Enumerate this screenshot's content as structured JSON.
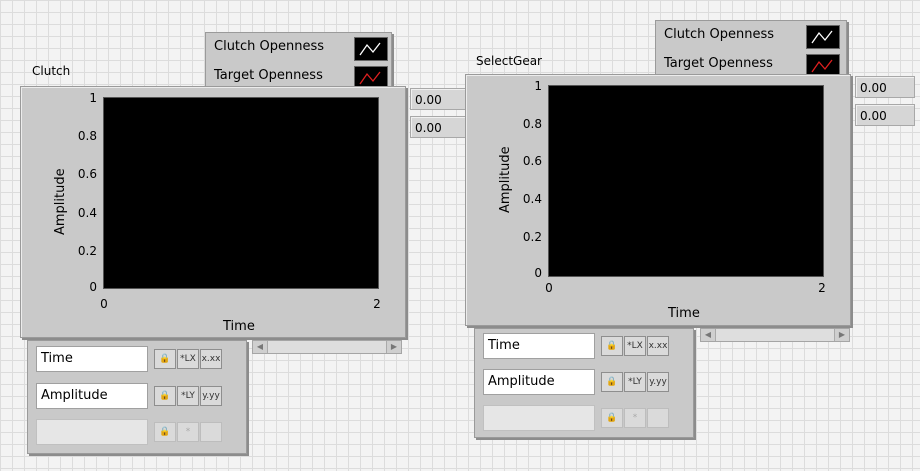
{
  "graphs": [
    {
      "caption": "Clutch",
      "legend": [
        {
          "label": "Clutch Openness",
          "color": "#ffffff"
        },
        {
          "label": "Target Openness",
          "color": "#e02020"
        }
      ],
      "x_axis_title": "Time",
      "y_axis_title": "Amplitude",
      "y_ticks": [
        "1",
        "0.8",
        "0.6",
        "0.4",
        "0.2",
        "0"
      ],
      "x_ticks": [
        "0",
        "2"
      ],
      "digital_displays": [
        "0.00",
        "0.00"
      ],
      "scale_legend": {
        "x_name": "Time",
        "y_name": "Amplitude",
        "x_format": "x.xx",
        "y_format": "y.yy"
      }
    },
    {
      "caption": "SelectGear",
      "legend": [
        {
          "label": "Clutch Openness",
          "color": "#ffffff"
        },
        {
          "label": "Target Openness",
          "color": "#e02020"
        }
      ],
      "x_axis_title": "Time",
      "y_axis_title": "Amplitude",
      "y_ticks": [
        "1",
        "0.8",
        "0.6",
        "0.4",
        "0.2",
        "0"
      ],
      "x_ticks": [
        "0",
        "2"
      ],
      "digital_displays": [
        "0.00",
        "0.00"
      ],
      "scale_legend": {
        "x_name": "Time",
        "y_name": "Amplitude",
        "x_format": "x.xx",
        "y_format": "y.yy"
      }
    }
  ],
  "icons": {
    "lock": "lock-icon",
    "autoscale_x": "autoscale-x-icon",
    "autoscale_y": "autoscale-y-icon",
    "format": "format-icon",
    "scroll_left": "arrow-left-icon",
    "scroll_right": "arrow-right-icon"
  }
}
